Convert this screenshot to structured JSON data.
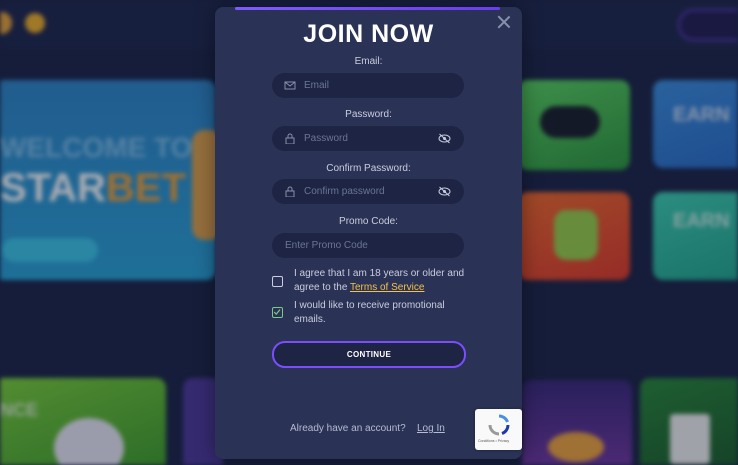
{
  "modal": {
    "title": "JOIN NOW",
    "email": {
      "label": "Email:",
      "placeholder": "Email",
      "icon": "mail-icon"
    },
    "password": {
      "label": "Password:",
      "placeholder": "Password",
      "icon": "lock-icon",
      "toggle_icon": "eye-slash-icon"
    },
    "confirm_password": {
      "label": "Confirm Password:",
      "placeholder": "Confirm password",
      "icon": "lock-icon",
      "toggle_icon": "eye-slash-icon"
    },
    "promo": {
      "label": "Promo Code:",
      "placeholder": "Enter Promo Code"
    },
    "age_checkbox": {
      "checked": false,
      "text": "I agree that I am 18 years or older and agree to the",
      "link": "Terms of Service"
    },
    "promo_checkbox": {
      "checked": true,
      "text": "I would like to receive promotional emails."
    },
    "continue_label": "CONTINUE",
    "already_text": "Already have an account?",
    "login_link": "Log In"
  },
  "recaptcha": {
    "text": "Conditions • Privacy"
  },
  "background": {
    "banner_text_1": "WELCOME TO",
    "banner_text_2a": "STAR",
    "banner_text_2b": "BET",
    "tile_text_1": "EARN",
    "tile_text_2": "EARN",
    "tile_text_3": "NCE"
  },
  "colors": {
    "modal_bg": "#2a3355",
    "field_bg": "#1d2444",
    "accent": "#7c4dff",
    "link": "#f2c14e",
    "check": "#7bc98c"
  }
}
